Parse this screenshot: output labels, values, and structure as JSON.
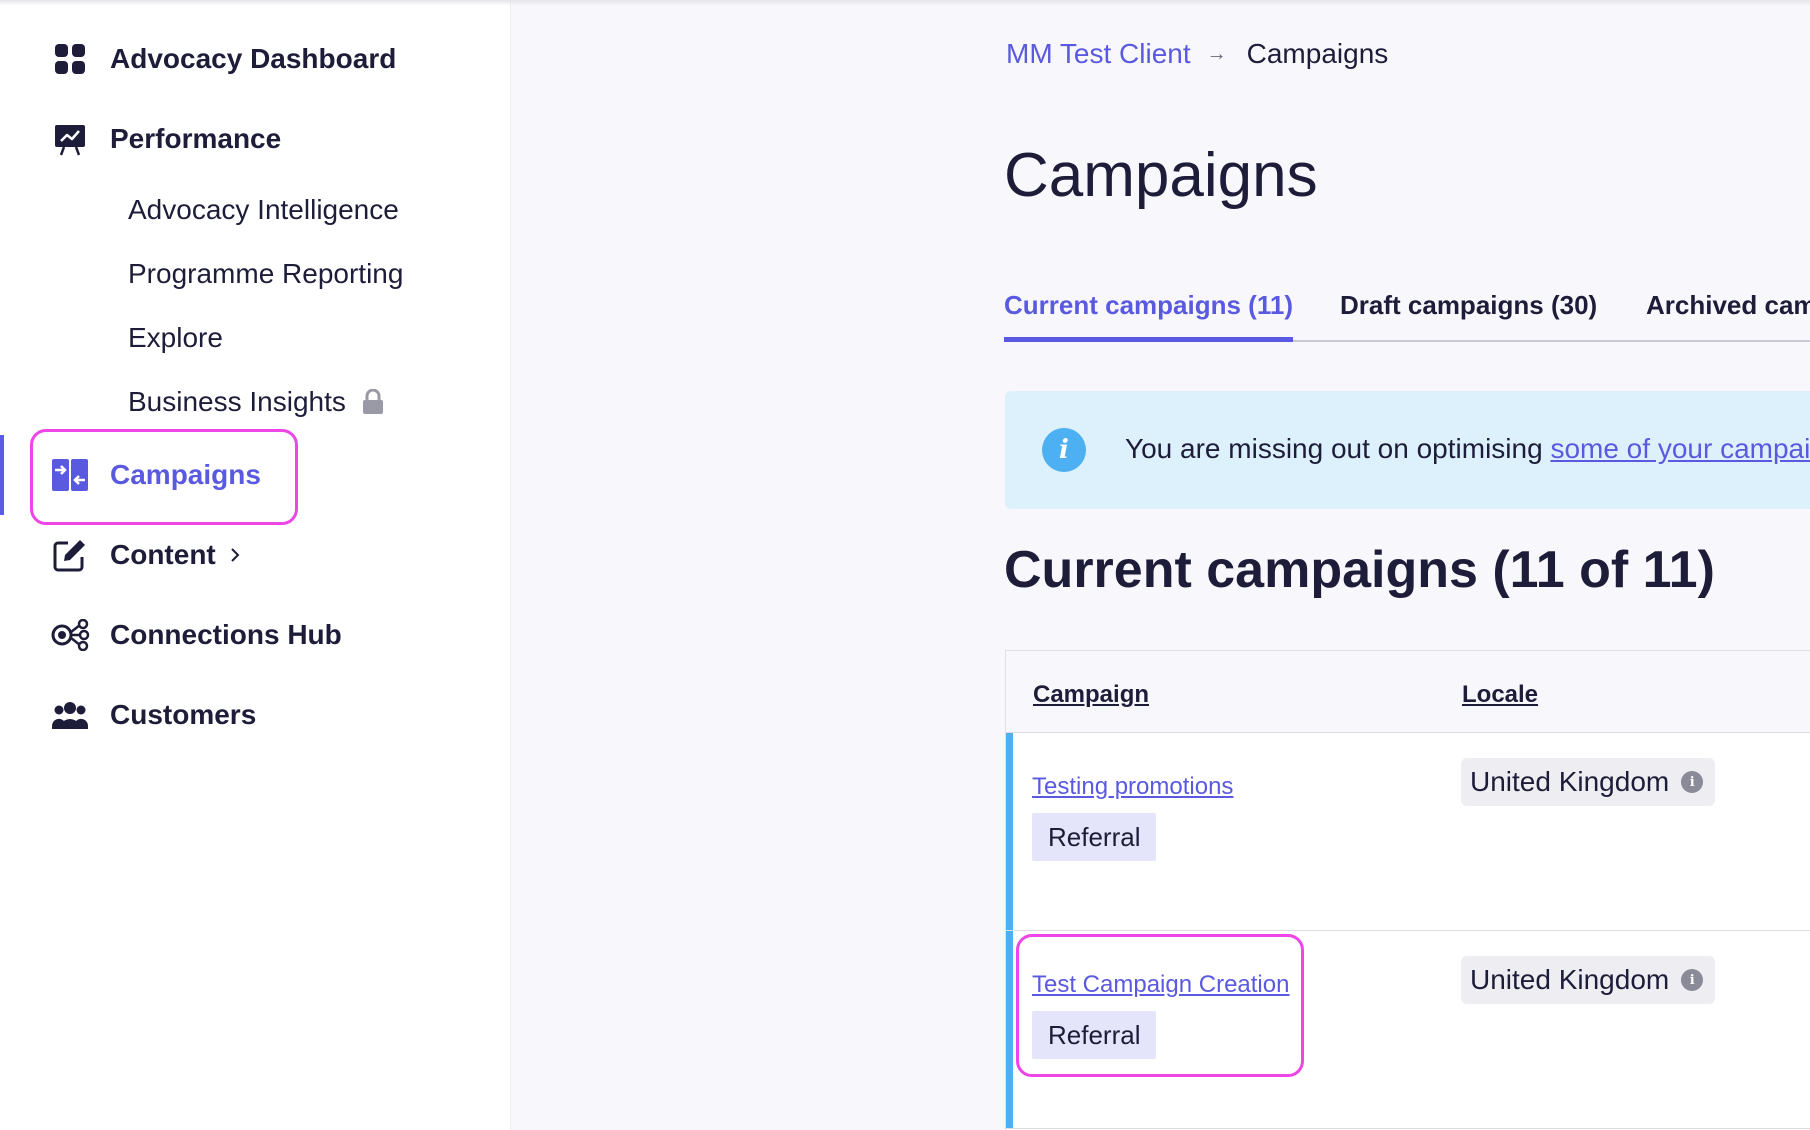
{
  "sidebar": {
    "items": [
      {
        "label": "Advocacy Dashboard",
        "icon": "grid-icon"
      },
      {
        "label": "Performance",
        "icon": "presentation-chart-icon"
      },
      {
        "label": "Campaigns",
        "icon": "campaigns-icon",
        "active": true
      },
      {
        "label": "Content",
        "icon": "edit-icon",
        "has_chevron": true
      },
      {
        "label": "Connections Hub",
        "icon": "connections-icon"
      },
      {
        "label": "Customers",
        "icon": "users-icon"
      }
    ],
    "performance_sub": [
      {
        "label": "Advocacy Intelligence"
      },
      {
        "label": "Programme Reporting"
      },
      {
        "label": "Explore"
      },
      {
        "label": "Business Insights",
        "locked": true
      }
    ]
  },
  "breadcrumb": {
    "client": "MM Test Client",
    "current": "Campaigns"
  },
  "page_title": "Campaigns",
  "tabs": [
    {
      "label": "Current campaigns (11)",
      "active": true
    },
    {
      "label": "Draft campaigns (30)"
    },
    {
      "label": "Archived camp"
    }
  ],
  "info_banner": {
    "text": "You are missing out on optimising ",
    "link": "some of your campai"
  },
  "section_title": "Current campaigns (11 of 11)",
  "table": {
    "headers": [
      "Campaign",
      "Locale"
    ],
    "rows": [
      {
        "name": "Testing promotions",
        "type": "Referral",
        "locale": "United Kingdom"
      },
      {
        "name": "Test Campaign Creation",
        "type": "Referral",
        "locale": "United Kingdom"
      }
    ]
  },
  "colors": {
    "accent": "#5a5ae0",
    "highlight": "#ee46e6",
    "info": "#4db0f3",
    "banner": "#ddf1fc",
    "text": "#1d1d3a"
  }
}
